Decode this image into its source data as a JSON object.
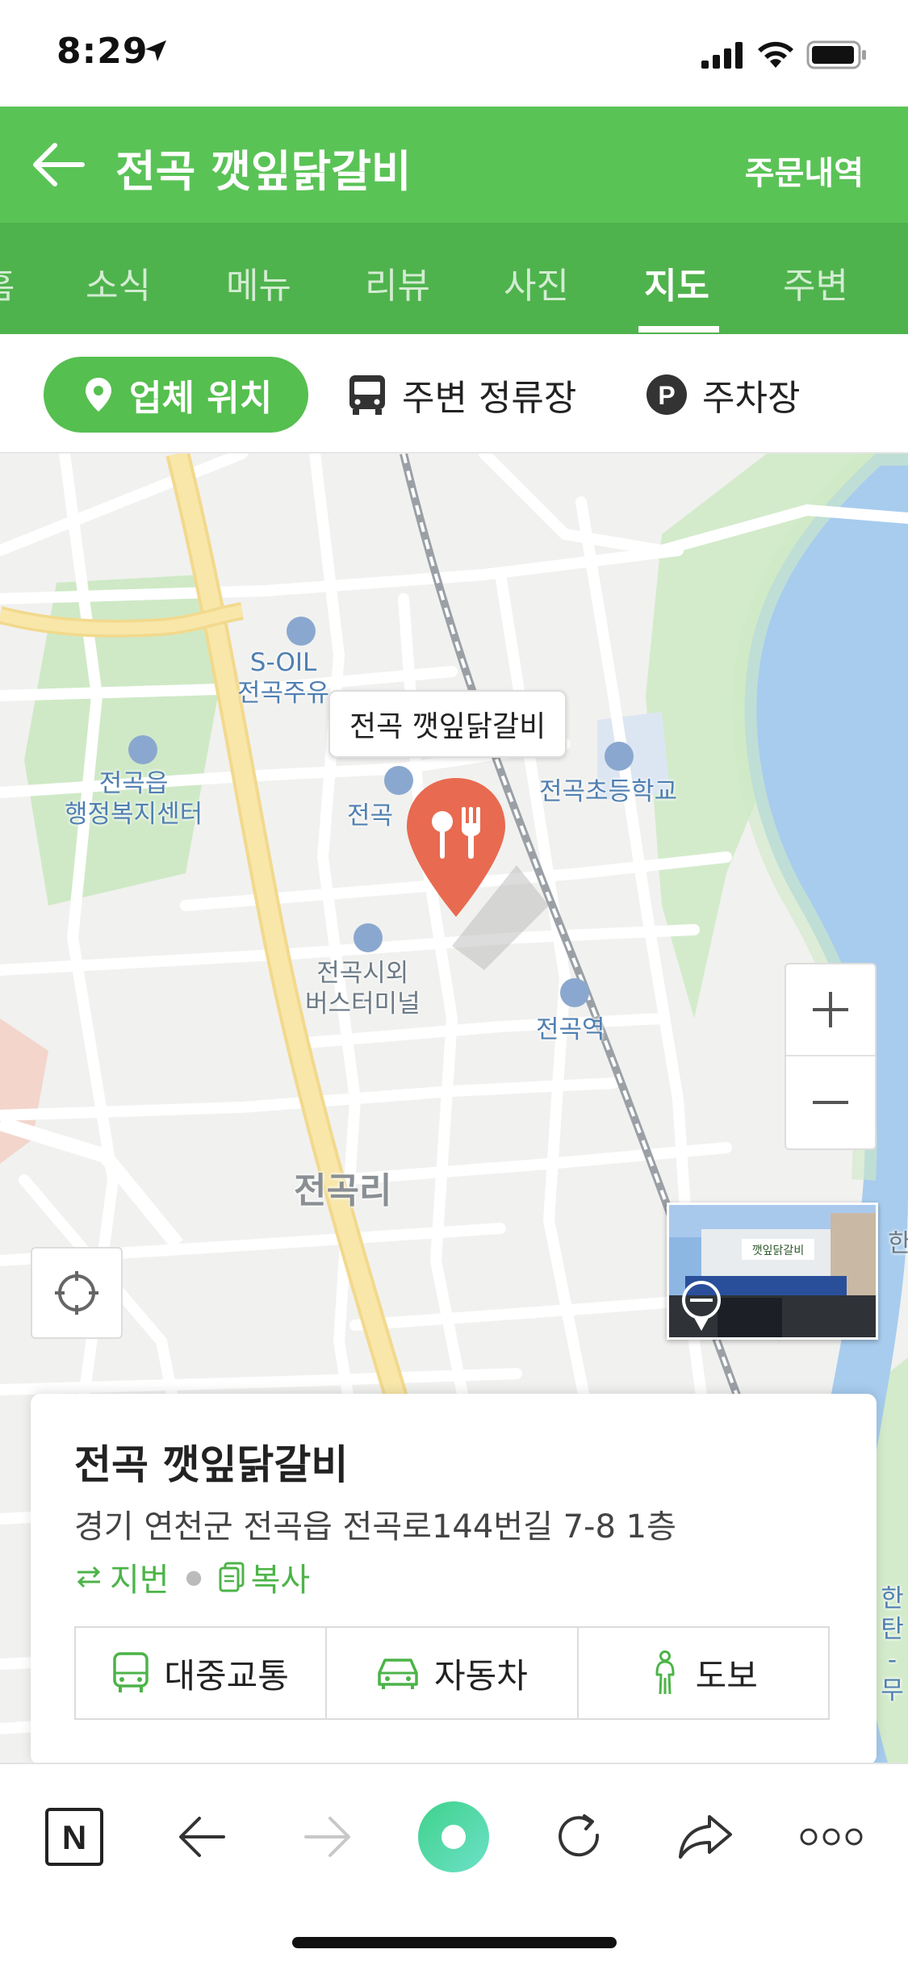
{
  "status_bar": {
    "time": "8:29"
  },
  "header": {
    "title": "전곡 깻잎닭갈비",
    "orders_label": "주문내역"
  },
  "tabs": [
    {
      "label": "홈",
      "active": false
    },
    {
      "label": "소식",
      "active": false
    },
    {
      "label": "메뉴",
      "active": false
    },
    {
      "label": "리뷰",
      "active": false
    },
    {
      "label": "사진",
      "active": false
    },
    {
      "label": "지도",
      "active": true
    },
    {
      "label": "주변",
      "active": false
    }
  ],
  "filters": {
    "location_label": "업체 위치",
    "stops_label": "주변 정류장",
    "parking_label": "주차장"
  },
  "map": {
    "callout": "전곡 깻잎닭갈비",
    "labels": {
      "soil": "S-OIL\n전곡주유",
      "office": "전곡읍\n행정복지센터",
      "market": "전곡",
      "school": "전곡초등학교",
      "terminal": "전곡시외\n버스터미널",
      "station": "전곡역",
      "district": "전곡리",
      "edge_right": "한",
      "edge_right2": "한탄\n-무"
    },
    "street_view_sign": "깻잎닭갈비"
  },
  "card": {
    "title": "전곡 깻잎닭갈비",
    "address": "경기 연천군 전곡읍 전곡로144번길 7-8 1층",
    "jibun_label": "지번",
    "copy_label": "복사",
    "routes": [
      {
        "label": "대중교통",
        "icon": "bus-icon"
      },
      {
        "label": "자동차",
        "icon": "car-icon"
      },
      {
        "label": "도보",
        "icon": "walk-icon"
      }
    ]
  },
  "colors": {
    "header_green": "#5ac356",
    "tab_green": "#4fb34d",
    "accent_green": "#4cb448",
    "pin_red": "#e86a50",
    "river_blue": "#a7ccee"
  }
}
